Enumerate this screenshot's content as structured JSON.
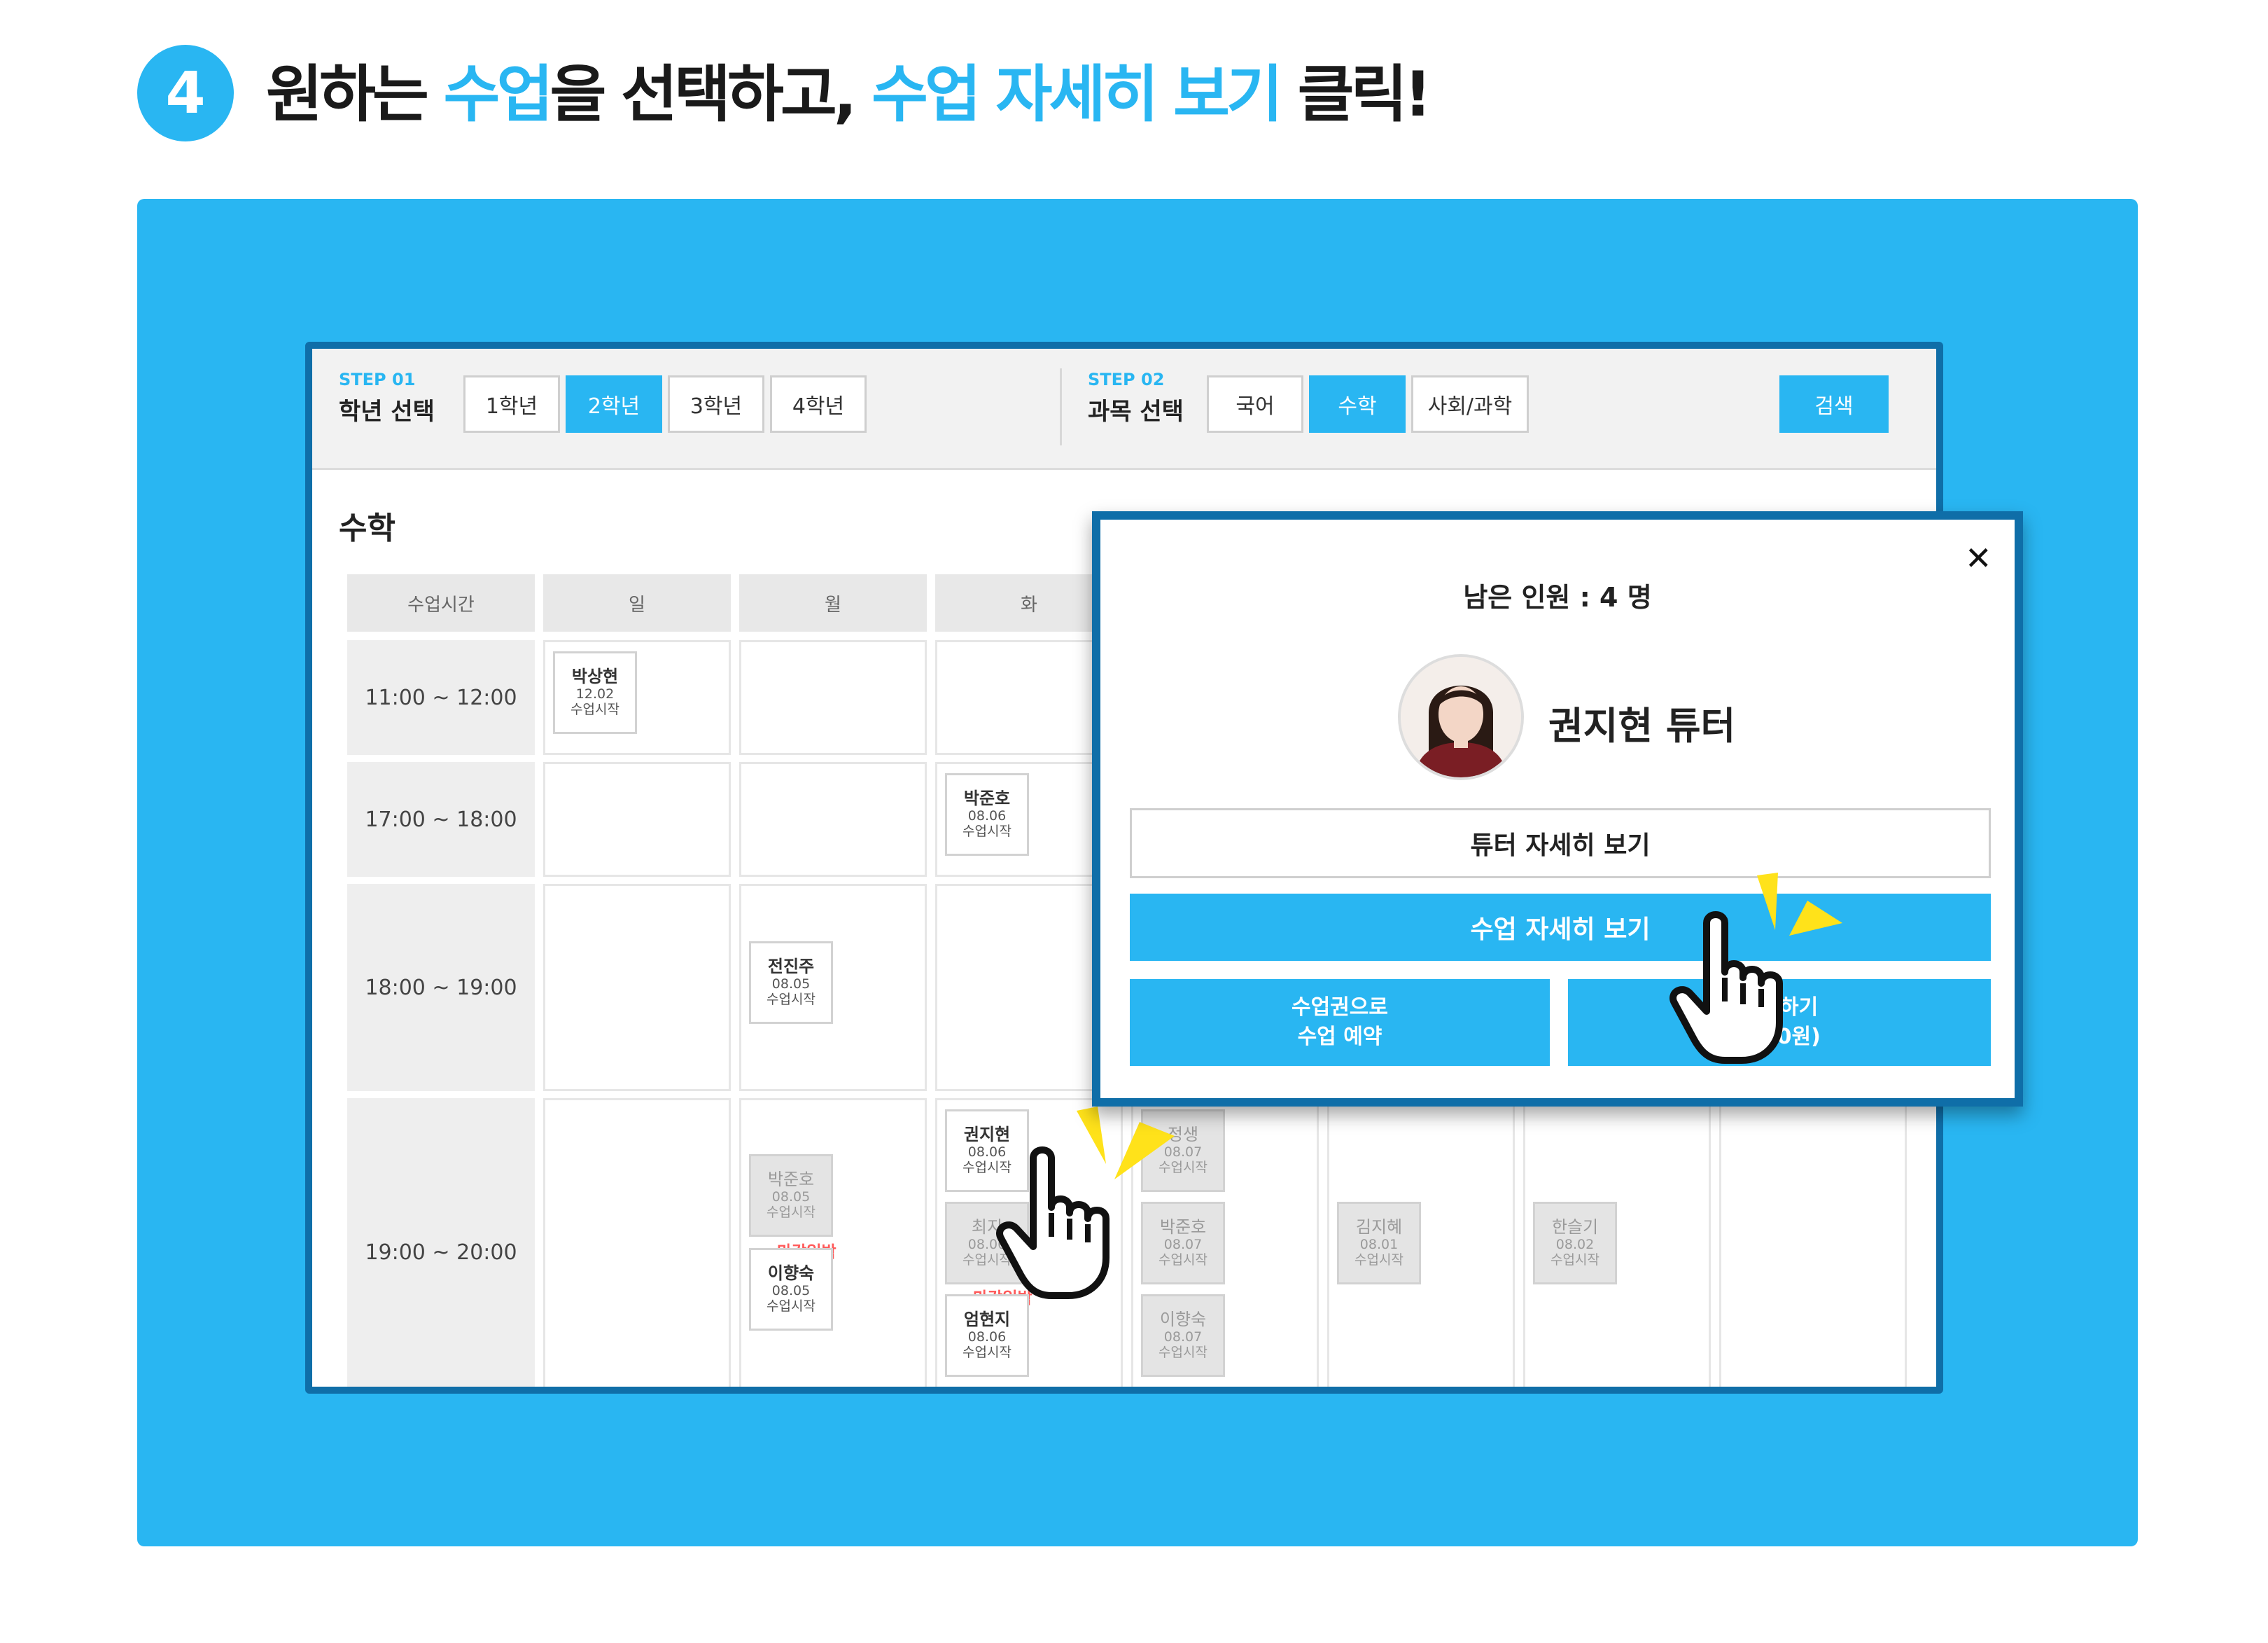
{
  "heading": {
    "step_number": "4",
    "part1": "원하는 ",
    "part2": "수업",
    "part3": "을 선택하고, ",
    "part4": "수업 자세히 보기",
    "part5": " 클릭!"
  },
  "step1": {
    "label": "STEP 01",
    "title": "학년 선택",
    "grades": [
      "1학년",
      "2학년",
      "3학년",
      "4학년"
    ],
    "active": "2학년"
  },
  "step2": {
    "label": "STEP 02",
    "title": "과목 선택",
    "subjects": [
      "국어",
      "수학",
      "사회/과학"
    ],
    "active": "수학"
  },
  "search_label": "검색",
  "subject_title": "수학",
  "schedule": {
    "headers": [
      "수업시간",
      "일",
      "월",
      "화"
    ],
    "time_slots": [
      "11:00 ~ 12:00",
      "17:00 ~ 18:00",
      "18:00 ~ 19:00",
      "19:00 ~ 20:00"
    ],
    "deadline_label": "마감임박",
    "cards": [
      {
        "name": "박상현",
        "date": "12.02",
        "status": "수업시작"
      },
      {
        "name": "박준호",
        "date": "08.06",
        "status": "수업시작"
      },
      {
        "name": "전진주",
        "date": "08.05",
        "status": "수업시작"
      },
      {
        "name": "박준호",
        "date": "08.05",
        "status": "수업시작"
      },
      {
        "name": "이향숙",
        "date": "08.05",
        "status": "수업시작"
      },
      {
        "name": "권지현",
        "date": "08.06",
        "status": "수업시작"
      },
      {
        "name": "최지",
        "date": "08.06",
        "status": "수업시작"
      },
      {
        "name": "엄현지",
        "date": "08.06",
        "status": "수업시작"
      },
      {
        "name": "정생",
        "date": "08.07",
        "status": "수업시작"
      },
      {
        "name": "박준호",
        "date": "08.07",
        "status": "수업시작"
      },
      {
        "name": "이향숙",
        "date": "08.07",
        "status": "수업시작"
      },
      {
        "name": "김지혜",
        "date": "08.01",
        "status": "수업시작"
      },
      {
        "name": "한슬기",
        "date": "08.02",
        "status": "수업시작"
      }
    ]
  },
  "popup": {
    "close": "✕",
    "remaining": "남은 인원 : 4 명",
    "tutor_name": "권지현 튜터",
    "tutor_detail": "튜터 자세히 보기",
    "class_detail": "수업 자세히 보기",
    "ticket_line1": "수업권으로",
    "ticket_line2": "수업 예약",
    "pay_line1": "예약하기",
    "pay_line2": "(000원)"
  },
  "colors": {
    "accent": "#29b6f2",
    "frame": "#0f6ea8",
    "deadline": "#ff5a5a"
  }
}
